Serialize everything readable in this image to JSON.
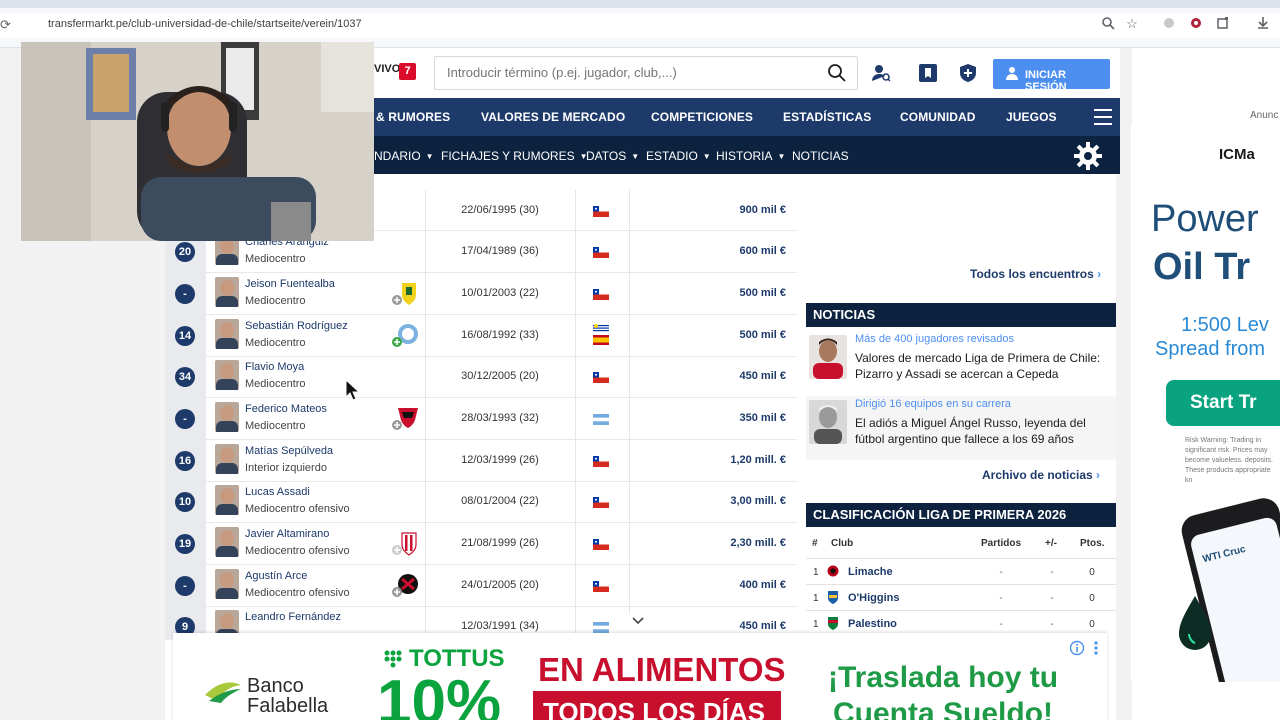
{
  "browser": {
    "url": "transfermarkt.pe/club-universidad-de-chile/startseite/verein/1037"
  },
  "header": {
    "vivo_label": "VIVO",
    "vivo_count": "7",
    "search_placeholder": "Introducir término (p.ej. jugador, club,...)",
    "login_label": "INICIAR SESIÓN"
  },
  "nav_main": [
    "& RUMORES",
    "VALORES DE MERCADO",
    "COMPETICIONES",
    "ESTADÍSTICAS",
    "COMUNIDAD",
    "JUEGOS"
  ],
  "nav_sub": [
    {
      "label": "NDARIO",
      "caret": true
    },
    {
      "label": "FICHAJES Y RUMORES",
      "caret": true
    },
    {
      "label": "DATOS",
      "caret": true
    },
    {
      "label": "ESTADIO",
      "caret": true
    },
    {
      "label": "HISTORIA",
      "caret": true
    },
    {
      "label": "NOTICIAS",
      "caret": false
    }
  ],
  "players": [
    {
      "number": "",
      "name": "",
      "position": "",
      "date": "22/06/1995 (30)",
      "flag": "chile",
      "value": "900 mil €",
      "club": ""
    },
    {
      "number": "20",
      "name": "Charles Aránguiz",
      "position": "Mediocentro",
      "date": "17/04/1989 (36)",
      "flag": "chile",
      "value": "600 mil €",
      "club": ""
    },
    {
      "number": "-",
      "name": "Jeison Fuentealba",
      "position": "Mediocentro",
      "date": "10/01/2003 (22)",
      "flag": "chile",
      "value": "500 mil €",
      "club": "yellow"
    },
    {
      "number": "14",
      "name": "Sebastián Rodríguez",
      "position": "Mediocentro",
      "date": "16/08/1992 (33)",
      "flag": "uruguay-spain",
      "value": "500 mil €",
      "club": "blue"
    },
    {
      "number": "34",
      "name": "Flavio Moya",
      "position": "Mediocentro",
      "date": "30/12/2005 (20)",
      "flag": "chile",
      "value": "450 mil €",
      "club": ""
    },
    {
      "number": "-",
      "name": "Federico Mateos",
      "position": "Mediocentro",
      "date": "28/03/1993 (32)",
      "flag": "argentina",
      "value": "350 mil €",
      "club": "red"
    },
    {
      "number": "16",
      "name": "Matías Sepúlveda",
      "position": "Interior izquierdo",
      "date": "12/03/1999 (26)",
      "flag": "chile",
      "value": "1,20 mill. €",
      "club": ""
    },
    {
      "number": "10",
      "name": "Lucas Assadi",
      "position": "Mediocentro ofensivo",
      "date": "08/01/2004 (22)",
      "flag": "chile",
      "value": "3,00 mill. €",
      "club": ""
    },
    {
      "number": "19",
      "name": "Javier Altamirano",
      "position": "Mediocentro ofensivo",
      "date": "21/08/1999 (26)",
      "flag": "chile",
      "value": "2,30 mill. €",
      "club": "estudiantes"
    },
    {
      "number": "-",
      "name": "Agustín Arce",
      "position": "Mediocentro ofensivo",
      "date": "24/01/2005 (20)",
      "flag": "chile",
      "value": "400 mil €",
      "club": "black-red"
    },
    {
      "number": "9",
      "name": "Leandro Fernández",
      "position": "",
      "date": "12/03/1991 (34)",
      "flag": "argentina",
      "value": "450 mil €",
      "club": ""
    }
  ],
  "encounters": {
    "link": "Todos los encuentros"
  },
  "news": {
    "title": "NOTICIAS",
    "items": [
      {
        "kicker": "Más de 400 jugadores revisados",
        "title": "Valores de mercado Liga de Primera de Chile: Pizarro y Assadi se acercan a Cepeda"
      },
      {
        "kicker": "Dirigió 16 equipos en su carrera",
        "title": "El adiós a Miguel Ángel Russo, leyenda del fútbol argentino que fallece a los 69 años"
      }
    ],
    "archive_link": "Archivo de noticias"
  },
  "standings": {
    "title": "CLASIFICACIÓN LIGA DE PRIMERA 2026",
    "headers": {
      "rank": "#",
      "club": "Club",
      "played": "Partidos",
      "diff": "+/-",
      "points": "Ptos."
    },
    "rows": [
      {
        "rank": "1",
        "club": "Limache",
        "played": "-",
        "diff": "-",
        "points": "0"
      },
      {
        "rank": "1",
        "club": "O'Higgins",
        "played": "-",
        "diff": "-",
        "points": "0"
      },
      {
        "rank": "1",
        "club": "Palestino",
        "played": "-",
        "diff": "-",
        "points": "0"
      }
    ]
  },
  "ad_right": {
    "label": "Anunc",
    "brand": "ICMa",
    "headline1": "Power",
    "headline2": "Oil Tr",
    "sub1": "1:500 Lev",
    "sub2": "Spread from",
    "cta": "Start Tr",
    "risk": "Risk Warning: Trading in significant risk. Prices may become valueless. deposits. These products appropriate kn",
    "phone_label": "WTI Cruc"
  },
  "ad_bottom": {
    "bank1": "Banco",
    "bank2": "Falabella",
    "tottus": "TOTTUS",
    "percent": "10%",
    "en_alimentos": "EN ALIMENTOS",
    "todos": "TODOS LOS DÍAS",
    "right1": "¡Traslada hoy tu",
    "right2": "Cuenta Sueldo!"
  },
  "colors": {
    "nav_primary": "#1d3a6b",
    "nav_secondary": "#0c223f",
    "login": "#4d8ff0",
    "accent_red": "#d90d2b",
    "tottus_green": "#0aa33d",
    "falabella_green": "#1f9a46"
  }
}
